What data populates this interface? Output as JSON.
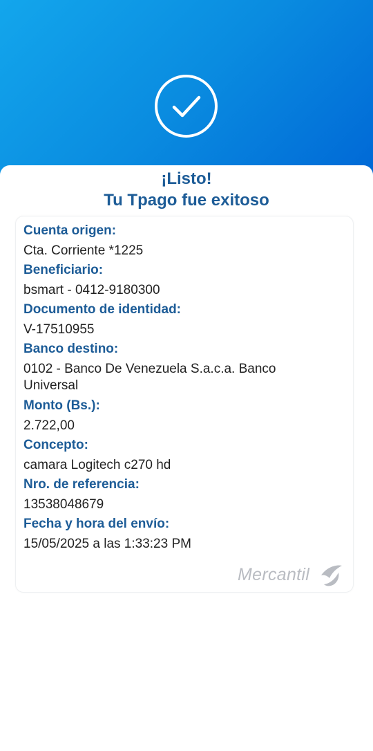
{
  "header": {
    "status_icon": "check-circle-icon"
  },
  "result": {
    "title_line1": "¡Listo!",
    "title_line2": "Tu Tpago fue exitoso"
  },
  "details": {
    "origin_account_label": "Cuenta origen:",
    "origin_account_value": "Cta. Corriente *1225",
    "beneficiary_label": "Beneficiario:",
    "beneficiary_value": "bsmart - 0412-9180300",
    "id_document_label": "Documento de identidad:",
    "id_document_value": "V-17510955",
    "destination_bank_label": "Banco destino:",
    "destination_bank_value": "0102 - Banco De Venezuela S.a.c.a. Banco Universal",
    "amount_label": "Monto (Bs.):",
    "amount_value": "2.722,00",
    "concept_label": "Concepto:",
    "concept_value": "camara Logitech c270 hd",
    "reference_label": "Nro. de referencia:",
    "reference_value": "13538048679",
    "sent_datetime_label": "Fecha y hora del envío:",
    "sent_datetime_value": "15/05/2025 a las 1:33:23 PM"
  },
  "brand": {
    "name": "Mercantil",
    "logo_icon": "mercantil-logo-icon"
  },
  "colors": {
    "header_gradient_start": "#13a6ec",
    "header_gradient_end": "#0068d6",
    "accent_text": "#1d5c97",
    "body_text": "#222222",
    "logo_gray": "#b9bcc2"
  }
}
